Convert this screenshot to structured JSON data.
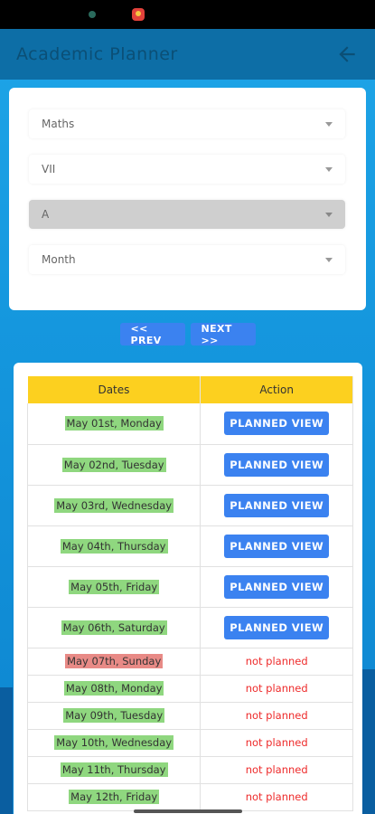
{
  "app_bar": {
    "title": "Academic Planner"
  },
  "form": {
    "subject": "Maths",
    "class": "VII",
    "section": "A",
    "month": "Month"
  },
  "nav": {
    "prev": "<< PREV",
    "next": "NEXT >>"
  },
  "table": {
    "headers": [
      "Dates",
      "Action"
    ],
    "rows": [
      {
        "date": "May 01st, Monday",
        "action": "PLANNED VIEW",
        "type": "button",
        "highlight": "green"
      },
      {
        "date": "May 02nd, Tuesday",
        "action": "PLANNED VIEW",
        "type": "button",
        "highlight": "green"
      },
      {
        "date": "May 03rd, Wednesday",
        "action": "PLANNED VIEW",
        "type": "button",
        "highlight": "green"
      },
      {
        "date": "May 04th, Thursday",
        "action": "PLANNED VIEW",
        "type": "button",
        "highlight": "green"
      },
      {
        "date": "May 05th, Friday",
        "action": "PLANNED VIEW",
        "type": "button",
        "highlight": "green"
      },
      {
        "date": "May 06th, Saturday",
        "action": "PLANNED VIEW",
        "type": "button",
        "highlight": "green"
      },
      {
        "date": "May 07th, Sunday",
        "action": "not planned",
        "type": "text",
        "highlight": "red"
      },
      {
        "date": "May 08th, Monday",
        "action": "not planned",
        "type": "text",
        "highlight": "green"
      },
      {
        "date": "May 09th, Tuesday",
        "action": "not planned",
        "type": "text",
        "highlight": "green"
      },
      {
        "date": "May 10th, Wednesday",
        "action": "not planned",
        "type": "text",
        "highlight": "green"
      },
      {
        "date": "May 11th, Thursday",
        "action": "not planned",
        "type": "text",
        "highlight": "green"
      },
      {
        "date": "May 12th, Friday",
        "action": "not planned",
        "type": "text",
        "highlight": "green"
      }
    ]
  },
  "colors": {
    "app_bar": "#0d6ea6",
    "button": "#3b82f0",
    "header": "#fcd01f",
    "highlight_green": "#8fd77f",
    "highlight_red": "#e88a86",
    "not_planned": "#ee2b2b"
  },
  "icons": {
    "back": "arrow-left-icon",
    "dropdown": "caret-down-icon"
  }
}
